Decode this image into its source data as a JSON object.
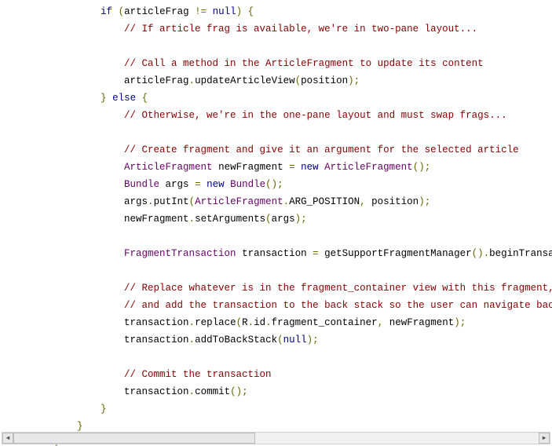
{
  "code": {
    "indent": "        ",
    "lines": [
      {
        "i": 2,
        "segs": [
          {
            "c": "kw",
            "t": "if"
          },
          {
            "c": "pln",
            "t": " "
          },
          {
            "c": "pun",
            "t": "("
          },
          {
            "c": "pln",
            "t": "articleFrag "
          },
          {
            "c": "pun",
            "t": "!="
          },
          {
            "c": "pln",
            "t": " "
          },
          {
            "c": "kw",
            "t": "null"
          },
          {
            "c": "pun",
            "t": ")"
          },
          {
            "c": "pln",
            "t": " "
          },
          {
            "c": "pun",
            "t": "{"
          }
        ]
      },
      {
        "i": 3,
        "segs": [
          {
            "c": "cmt",
            "t": "// If article frag is available, we're in two-pane layout..."
          }
        ]
      },
      {
        "i": 0,
        "segs": [
          {
            "c": "pln",
            "t": ""
          }
        ]
      },
      {
        "i": 3,
        "segs": [
          {
            "c": "cmt",
            "t": "// Call a method in the ArticleFragment to update its content"
          }
        ]
      },
      {
        "i": 3,
        "segs": [
          {
            "c": "pln",
            "t": "articleFrag"
          },
          {
            "c": "pun",
            "t": "."
          },
          {
            "c": "pln",
            "t": "updateArticleView"
          },
          {
            "c": "pun",
            "t": "("
          },
          {
            "c": "pln",
            "t": "position"
          },
          {
            "c": "pun",
            "t": ");"
          }
        ]
      },
      {
        "i": 2,
        "segs": [
          {
            "c": "pun",
            "t": "}"
          },
          {
            "c": "pln",
            "t": " "
          },
          {
            "c": "kw",
            "t": "else"
          },
          {
            "c": "pln",
            "t": " "
          },
          {
            "c": "pun",
            "t": "{"
          }
        ]
      },
      {
        "i": 3,
        "segs": [
          {
            "c": "cmt",
            "t": "// Otherwise, we're in the one-pane layout and must swap frags..."
          }
        ]
      },
      {
        "i": 0,
        "segs": [
          {
            "c": "pln",
            "t": ""
          }
        ]
      },
      {
        "i": 3,
        "segs": [
          {
            "c": "cmt",
            "t": "// Create fragment and give it an argument for the selected article"
          }
        ]
      },
      {
        "i": 3,
        "segs": [
          {
            "c": "typ",
            "t": "ArticleFragment"
          },
          {
            "c": "pln",
            "t": " newFragment "
          },
          {
            "c": "pun",
            "t": "="
          },
          {
            "c": "pln",
            "t": " "
          },
          {
            "c": "kw",
            "t": "new"
          },
          {
            "c": "pln",
            "t": " "
          },
          {
            "c": "typ",
            "t": "ArticleFragment"
          },
          {
            "c": "pun",
            "t": "();"
          }
        ]
      },
      {
        "i": 3,
        "segs": [
          {
            "c": "typ",
            "t": "Bundle"
          },
          {
            "c": "pln",
            "t": " args "
          },
          {
            "c": "pun",
            "t": "="
          },
          {
            "c": "pln",
            "t": " "
          },
          {
            "c": "kw",
            "t": "new"
          },
          {
            "c": "pln",
            "t": " "
          },
          {
            "c": "typ",
            "t": "Bundle"
          },
          {
            "c": "pun",
            "t": "();"
          }
        ]
      },
      {
        "i": 3,
        "segs": [
          {
            "c": "pln",
            "t": "args"
          },
          {
            "c": "pun",
            "t": "."
          },
          {
            "c": "pln",
            "t": "putInt"
          },
          {
            "c": "pun",
            "t": "("
          },
          {
            "c": "typ",
            "t": "ArticleFragment"
          },
          {
            "c": "pun",
            "t": "."
          },
          {
            "c": "pln",
            "t": "ARG_POSITION"
          },
          {
            "c": "pun",
            "t": ","
          },
          {
            "c": "pln",
            "t": " position"
          },
          {
            "c": "pun",
            "t": ");"
          }
        ]
      },
      {
        "i": 3,
        "segs": [
          {
            "c": "pln",
            "t": "newFragment"
          },
          {
            "c": "pun",
            "t": "."
          },
          {
            "c": "pln",
            "t": "setArguments"
          },
          {
            "c": "pun",
            "t": "("
          },
          {
            "c": "pln",
            "t": "args"
          },
          {
            "c": "pun",
            "t": ");"
          }
        ]
      },
      {
        "i": 0,
        "segs": [
          {
            "c": "pln",
            "t": ""
          }
        ]
      },
      {
        "i": 3,
        "segs": [
          {
            "c": "typ",
            "t": "FragmentTransaction"
          },
          {
            "c": "pln",
            "t": " transaction "
          },
          {
            "c": "pun",
            "t": "="
          },
          {
            "c": "pln",
            "t": " getSupportFragmentManager"
          },
          {
            "c": "pun",
            "t": "()."
          },
          {
            "c": "pln",
            "t": "beginTransac"
          }
        ]
      },
      {
        "i": 0,
        "segs": [
          {
            "c": "pln",
            "t": ""
          }
        ]
      },
      {
        "i": 3,
        "segs": [
          {
            "c": "cmt",
            "t": "// Replace whatever is in the fragment_container view with this fragment,"
          }
        ]
      },
      {
        "i": 3,
        "segs": [
          {
            "c": "cmt",
            "t": "// and add the transaction to the back stack so the user can navigate back"
          }
        ]
      },
      {
        "i": 3,
        "segs": [
          {
            "c": "pln",
            "t": "transaction"
          },
          {
            "c": "pun",
            "t": "."
          },
          {
            "c": "pln",
            "t": "replace"
          },
          {
            "c": "pun",
            "t": "("
          },
          {
            "c": "pln",
            "t": "R"
          },
          {
            "c": "pun",
            "t": "."
          },
          {
            "c": "pln",
            "t": "id"
          },
          {
            "c": "pun",
            "t": "."
          },
          {
            "c": "pln",
            "t": "fragment_container"
          },
          {
            "c": "pun",
            "t": ","
          },
          {
            "c": "pln",
            "t": " newFragment"
          },
          {
            "c": "pun",
            "t": ");"
          }
        ]
      },
      {
        "i": 3,
        "segs": [
          {
            "c": "pln",
            "t": "transaction"
          },
          {
            "c": "pun",
            "t": "."
          },
          {
            "c": "pln",
            "t": "addToBackStack"
          },
          {
            "c": "pun",
            "t": "("
          },
          {
            "c": "kw",
            "t": "null"
          },
          {
            "c": "pun",
            "t": ");"
          }
        ]
      },
      {
        "i": 0,
        "segs": [
          {
            "c": "pln",
            "t": ""
          }
        ]
      },
      {
        "i": 3,
        "segs": [
          {
            "c": "cmt",
            "t": "// Commit the transaction"
          }
        ]
      },
      {
        "i": 3,
        "segs": [
          {
            "c": "pln",
            "t": "transaction"
          },
          {
            "c": "pun",
            "t": "."
          },
          {
            "c": "pln",
            "t": "commit"
          },
          {
            "c": "pun",
            "t": "();"
          }
        ]
      },
      {
        "i": 2,
        "segs": [
          {
            "c": "pun",
            "t": "}"
          }
        ]
      },
      {
        "i": 1,
        "segs": [
          {
            "c": "pun",
            "t": "}"
          }
        ]
      },
      {
        "i": 0,
        "segs": [
          {
            "c": "pun",
            "t": "}"
          }
        ]
      }
    ]
  },
  "scrollbar": {
    "left_glyph": "◄",
    "right_glyph": "►"
  }
}
